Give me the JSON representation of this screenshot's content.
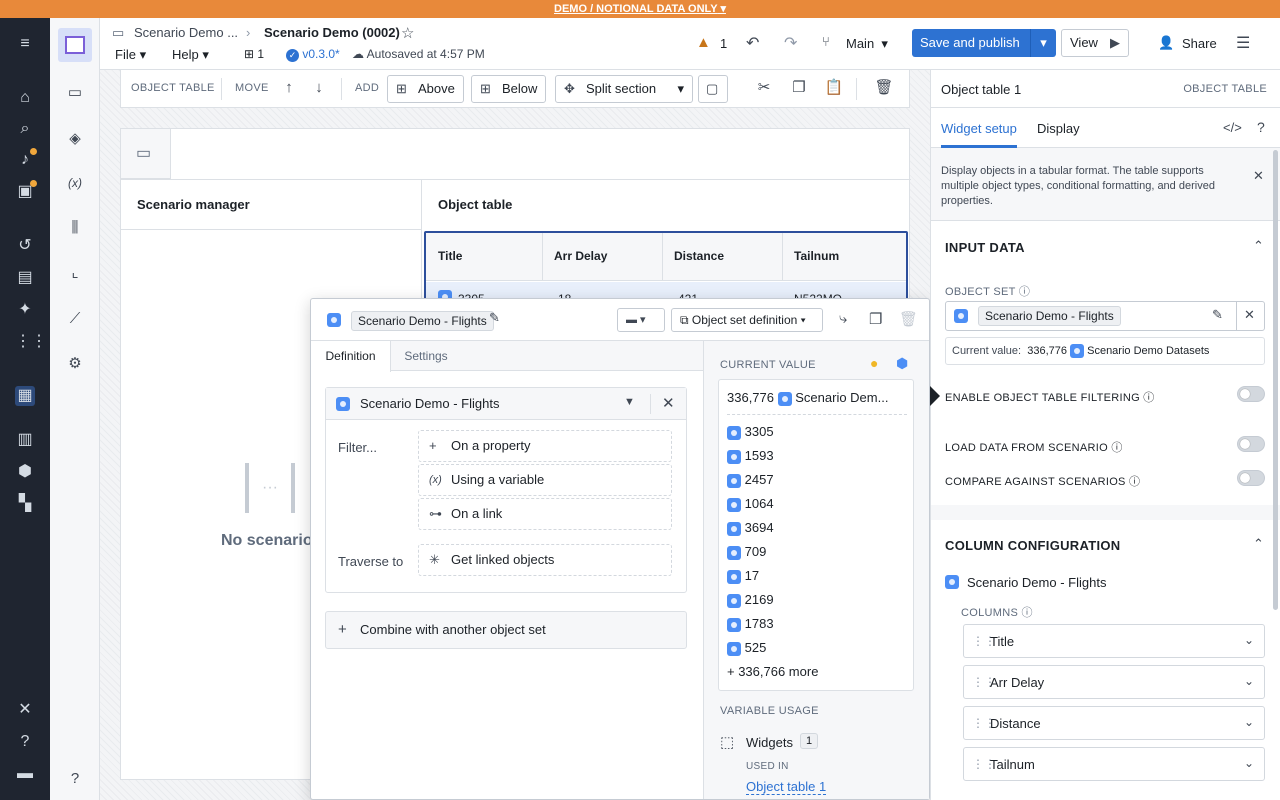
{
  "banner": "DEMO / NOTIONAL DATA ONLY",
  "header": {
    "breadcrumb_parent": "Scenario Demo ...",
    "title": "Scenario Demo (0002)",
    "menu_file": "File",
    "menu_help": "Help",
    "page_count": "1",
    "version": "v0.3.0*",
    "autosave": "Autosaved at 4:57 PM",
    "issues_count": "1",
    "branch": "Main",
    "save_label": "Save and publish",
    "view_label": "View",
    "share_label": "Share"
  },
  "toolbar": {
    "object_table": "OBJECT TABLE",
    "move": "MOVE",
    "add": "ADD",
    "above": "Above",
    "below": "Below",
    "split": "Split section"
  },
  "page": {
    "col1_header": "Scenario manager",
    "col2_header": "Object table",
    "empty_text": "No scenario",
    "table_headers": [
      "Title",
      "Arr Delay",
      "Distance",
      "Tailnum"
    ],
    "first_row": [
      "3305",
      "18",
      "421",
      "N522MQ"
    ]
  },
  "popup": {
    "object_set_name": "Scenario Demo - Flights",
    "def_type": "Object set definition",
    "tab_definition": "Definition",
    "tab_settings": "Settings",
    "source_name": "Scenario Demo - Flights",
    "filter_label": "Filter...",
    "opt_property": "On a property",
    "opt_variable": "Using a variable",
    "opt_link": "On a link",
    "traverse_label": "Traverse to",
    "opt_linked": "Get linked objects",
    "combine": "Combine with another object set",
    "current_value_label": "CURRENT VALUE",
    "count": "336,776",
    "count_source": "Scenario Dem...",
    "items": [
      "3305",
      "1593",
      "2457",
      "1064",
      "3694",
      "709",
      "17",
      "2169",
      "1783",
      "525"
    ],
    "more": "+ 336,766 more",
    "usage_label": "VARIABLE USAGE",
    "widgets_label": "Widgets",
    "widgets_count": "1",
    "used_in_label": "USED IN",
    "used_in_link": "Object table 1"
  },
  "rpanel": {
    "title": "Object table 1",
    "type": "OBJECT TABLE",
    "tab_setup": "Widget setup",
    "tab_display": "Display",
    "description": "Display objects in a tabular format. The table supports multiple object types, conditional formatting, and derived properties.",
    "input_data": "INPUT DATA",
    "object_set_label": "OBJECT SET",
    "object_set_value": "Scenario Demo - Flights",
    "current_value_label": "Current value:",
    "current_value_count": "336,776",
    "current_value_source": "Scenario Demo Datasets",
    "enable_filtering": "ENABLE OBJECT TABLE FILTERING",
    "load_scenario": "LOAD DATA FROM SCENARIO",
    "compare_scenarios": "COMPARE AGAINST SCENARIOS",
    "column_config": "COLUMN CONFIGURATION",
    "object_type": "Scenario Demo - Flights",
    "columns_label": "COLUMNS",
    "columns": [
      "Title",
      "Arr Delay",
      "Distance",
      "Tailnum"
    ]
  },
  "colors": {
    "accent": "#2d72d2",
    "banner": "#e8893a",
    "rail": "#1f2530"
  }
}
